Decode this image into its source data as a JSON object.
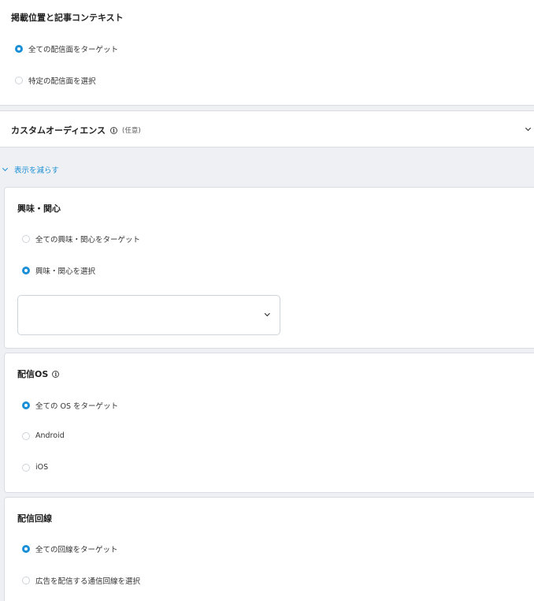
{
  "placement": {
    "title": "掲載位置と記事コンテキスト",
    "options": [
      "全ての配信面をターゲット",
      "特定の配信面を選択"
    ],
    "selected": 0
  },
  "custom_audience": {
    "title": "カスタムオーディエンス",
    "optional": "(任意)"
  },
  "toggle": {
    "label": "表示を減らす"
  },
  "interests": {
    "title": "興味・関心",
    "options": [
      "全ての興味・関心をターゲット",
      "興味・関心を選択"
    ],
    "selected": 1,
    "select_value": ""
  },
  "os": {
    "title": "配信OS",
    "options": [
      "全ての OS をターゲット",
      "Android",
      "iOS"
    ],
    "selected": 0
  },
  "network": {
    "title": "配信回線",
    "options": [
      "全ての回線をターゲット",
      "広告を配信する通信回線を選択"
    ],
    "selected": 0
  },
  "colors": {
    "accent": "#1a8fd6",
    "border": "#d9dce2",
    "background": "#eef0f4"
  },
  "icons": [
    "info-icon",
    "chevron-down-icon",
    "chevron-up-icon"
  ]
}
